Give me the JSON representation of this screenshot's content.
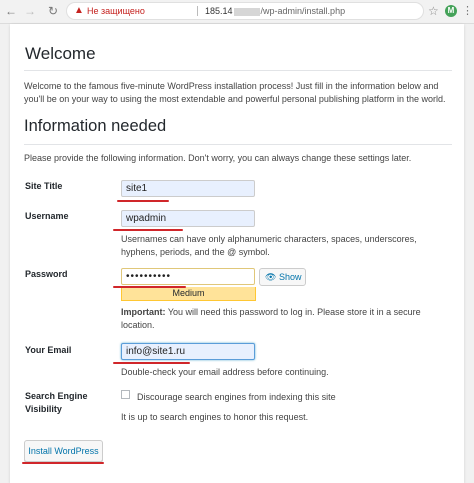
{
  "browser": {
    "insecure_label": "Не защищено",
    "url_host": "185.14",
    "url_path": "/wp-admin/install.php",
    "profile_initial": "M"
  },
  "page": {
    "welcome_title": "Welcome",
    "intro_text": "Welcome to the famous five-minute WordPress installation process! Just fill in the information below and you'll be on your way to using the most extendable and powerful personal publishing platform in the world.",
    "info_title": "Information needed",
    "provide_text": "Please provide the following information. Don't worry, you can always change these settings later."
  },
  "form": {
    "site_title": {
      "label": "Site Title",
      "value": "site1"
    },
    "username": {
      "label": "Username",
      "value": "wpadmin",
      "hint": "Usernames can have only alphanumeric characters, spaces, underscores, hyphens, periods, and the @ symbol."
    },
    "password": {
      "label": "Password",
      "value": "••••••••••",
      "strength": "Medium",
      "show_label": "Show",
      "important_label": "Important:",
      "important_text": "You will need this password to log in. Please store it in a secure location."
    },
    "email": {
      "label": "Your Email",
      "value": "info@site1.ru",
      "hint": "Double-check your email address before continuing."
    },
    "search_visibility": {
      "label": "Search Engine Visibility",
      "checkbox_label": "Discourage search engines from indexing this site",
      "checked": false,
      "hint": "It is up to search engines to honor this request."
    },
    "submit_label": "Install WordPress"
  },
  "colors": {
    "annotation_red": "#d0262a",
    "link_blue": "#0073aa",
    "strength_medium": "#ffe399"
  }
}
